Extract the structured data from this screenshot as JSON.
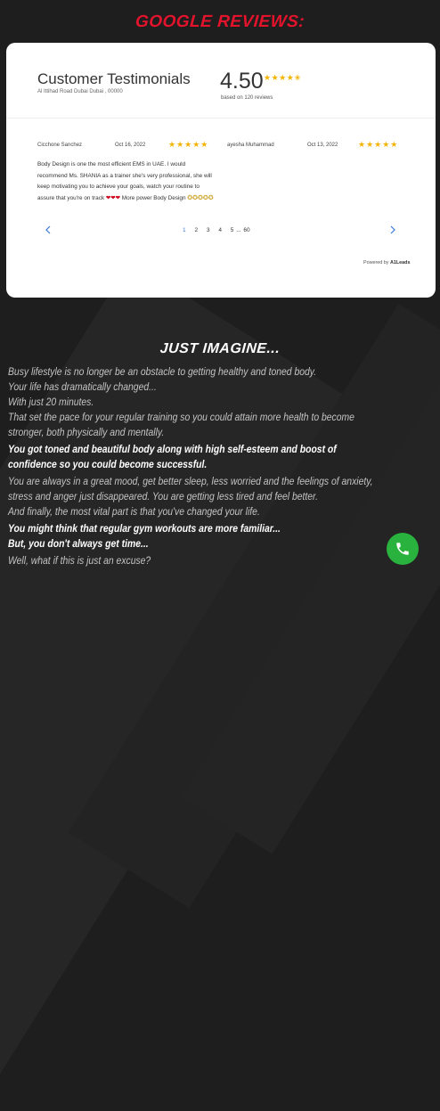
{
  "header": {
    "title": "GOOGLE REVIEWS:"
  },
  "card": {
    "title": "Customer Testimonials",
    "address": "Al Ittihad Road Dubai Dubai , 00000",
    "rating": "4.50",
    "rating_stars": "★★★★✬",
    "based_on": "based on 120 reviews"
  },
  "reviews": [
    {
      "name": "Cicchone Sanchez",
      "date": "Oct 16, 2022",
      "stars": "★★★★★",
      "text": "Body Design is one the most efficient EMS in UAE. I would recommend Ms. SHANIA as a trainer she's very professional, she will keep motivating you to achieve your goals, watch your routine to assure that you're on track",
      "hearts": "❤❤❤",
      "more": "More",
      "tail": "power Body Design",
      "tail_stars": "✪✪✪✪✪"
    },
    {
      "name": "ayesha Muhammad",
      "date": "Oct 13, 2022",
      "stars": "★★★★★"
    }
  ],
  "pagination": {
    "pages": [
      "1",
      "2",
      "3",
      "4",
      "5"
    ],
    "ellipsis": "...",
    "last": "60",
    "active": "1"
  },
  "powered_by": {
    "prefix": "Powered by",
    "brand": "A1Leads"
  },
  "imagine": {
    "title": "JUST IMAGINE..."
  },
  "paragraphs": [
    "Busy lifestyle is no longer be an obstacle to getting healthy and toned body.",
    "Your life has dramatically changed...",
    "With just 20 minutes.",
    "That set the pace for your regular training so you could attain more health to become stronger, both physically and mentally.",
    "You got toned and beautiful body along with high self-esteem and boost of confidence so you could become successful.",
    "You are always in a great mood, get better sleep, less worried and the feelings of anxiety, stress and anger just disappeared. You are getting less tired and feel better.",
    "And finally, the most vital part is that you've changed your life.",
    "You might think that regular gym workouts are more familiar...",
    "But, you don't always get time...",
    "Well, what if this is just an excuse?"
  ],
  "colors": {
    "accent_red": "#e3132c",
    "star": "#f5b301",
    "link_blue": "#3b7ad8",
    "phone_green": "#29b23d"
  },
  "icons": {
    "prev": "chevron-left-icon",
    "next": "chevron-right-icon",
    "phone": "phone-icon"
  }
}
